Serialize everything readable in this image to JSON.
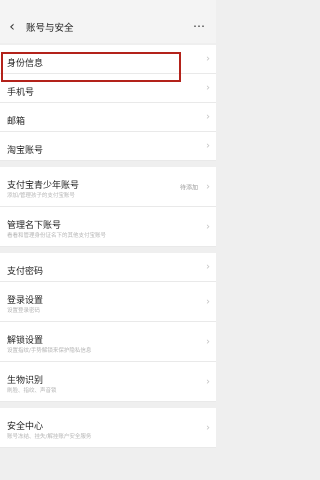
{
  "header": {
    "title": "账号与安全"
  },
  "sections": [
    [
      {
        "label": "身份信息"
      },
      {
        "label": "手机号"
      },
      {
        "label": "邮箱"
      },
      {
        "label": "淘宝账号"
      }
    ],
    [
      {
        "label": "支付宝青少年账号",
        "sub": "添加/管理孩子的支付宝账号",
        "value": "待添加"
      },
      {
        "label": "管理名下账号",
        "sub": "看看和管理身份证名下的其他支付宝账号"
      }
    ],
    [
      {
        "label": "支付密码"
      },
      {
        "label": "登录设置",
        "sub": "设置登录密码"
      },
      {
        "label": "解锁设置",
        "sub": "设置指纹/手势解锁来保护隐私信息"
      },
      {
        "label": "生物识别",
        "sub": "刷脸、指纹、声音锁"
      }
    ],
    [
      {
        "label": "安全中心",
        "sub": "账号冻结、挂失/解挂账户安全服务"
      }
    ]
  ]
}
